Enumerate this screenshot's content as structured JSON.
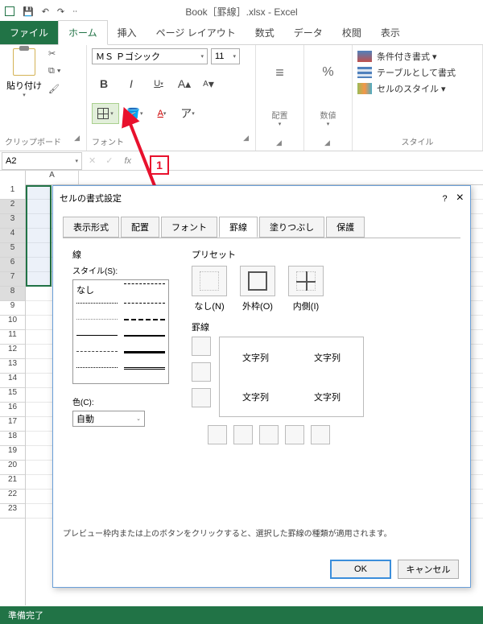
{
  "window": {
    "title": "Book［罫線］.xlsx - Excel"
  },
  "qat": {
    "save": "💾",
    "undo": "↶",
    "redo": "↷"
  },
  "tabs": {
    "file": "ファイル",
    "home": "ホーム",
    "insert": "挿入",
    "pagelayout": "ページ レイアウト",
    "formulas": "数式",
    "data": "データ",
    "review": "校閲",
    "view": "表示"
  },
  "ribbon": {
    "clipboard": {
      "paste": "貼り付け",
      "label": "クリップボード"
    },
    "font": {
      "name": "ＭＳ Ｐゴシック",
      "size": "11",
      "bold": "B",
      "italic": "I",
      "underline": "U",
      "grow": "A",
      "shrink": "A",
      "label": "フォント"
    },
    "alignment": {
      "label": "配置"
    },
    "number": {
      "btn": "%",
      "label": "数値"
    },
    "styles": {
      "cond": "条件付き書式 ▾",
      "table": "テーブルとして書式",
      "cell": "セルのスタイル ▾",
      "label": "スタイル"
    }
  },
  "callout": {
    "num": "1"
  },
  "namebox": "A2",
  "rows": [
    "1",
    "2",
    "3",
    "4",
    "5",
    "6",
    "7",
    "8",
    "9",
    "10",
    "11",
    "12",
    "13",
    "14",
    "15",
    "16",
    "17",
    "18",
    "19",
    "20",
    "21",
    "22",
    "23"
  ],
  "cols": [
    "A"
  ],
  "dialog": {
    "title": "セルの書式設定",
    "help": "?",
    "close": "×",
    "tabs": {
      "number": "表示形式",
      "alignment": "配置",
      "font": "フォント",
      "border": "罫線",
      "fill": "塗りつぶし",
      "protection": "保護"
    },
    "line_group": "線",
    "style_label": "スタイル(S):",
    "style_none": "なし",
    "color_label": "色(C):",
    "color_auto": "自動",
    "preset_group": "プリセット",
    "preset_none": "なし(N)",
    "preset_outline": "外枠(O)",
    "preset_inside": "内側(I)",
    "border_group": "罫線",
    "sample": "文字列",
    "hint": "プレビュー枠内または上のボタンをクリックすると、選択した罫線の種類が適用されます。",
    "ok": "OK",
    "cancel": "キャンセル"
  },
  "status": "準備完了"
}
